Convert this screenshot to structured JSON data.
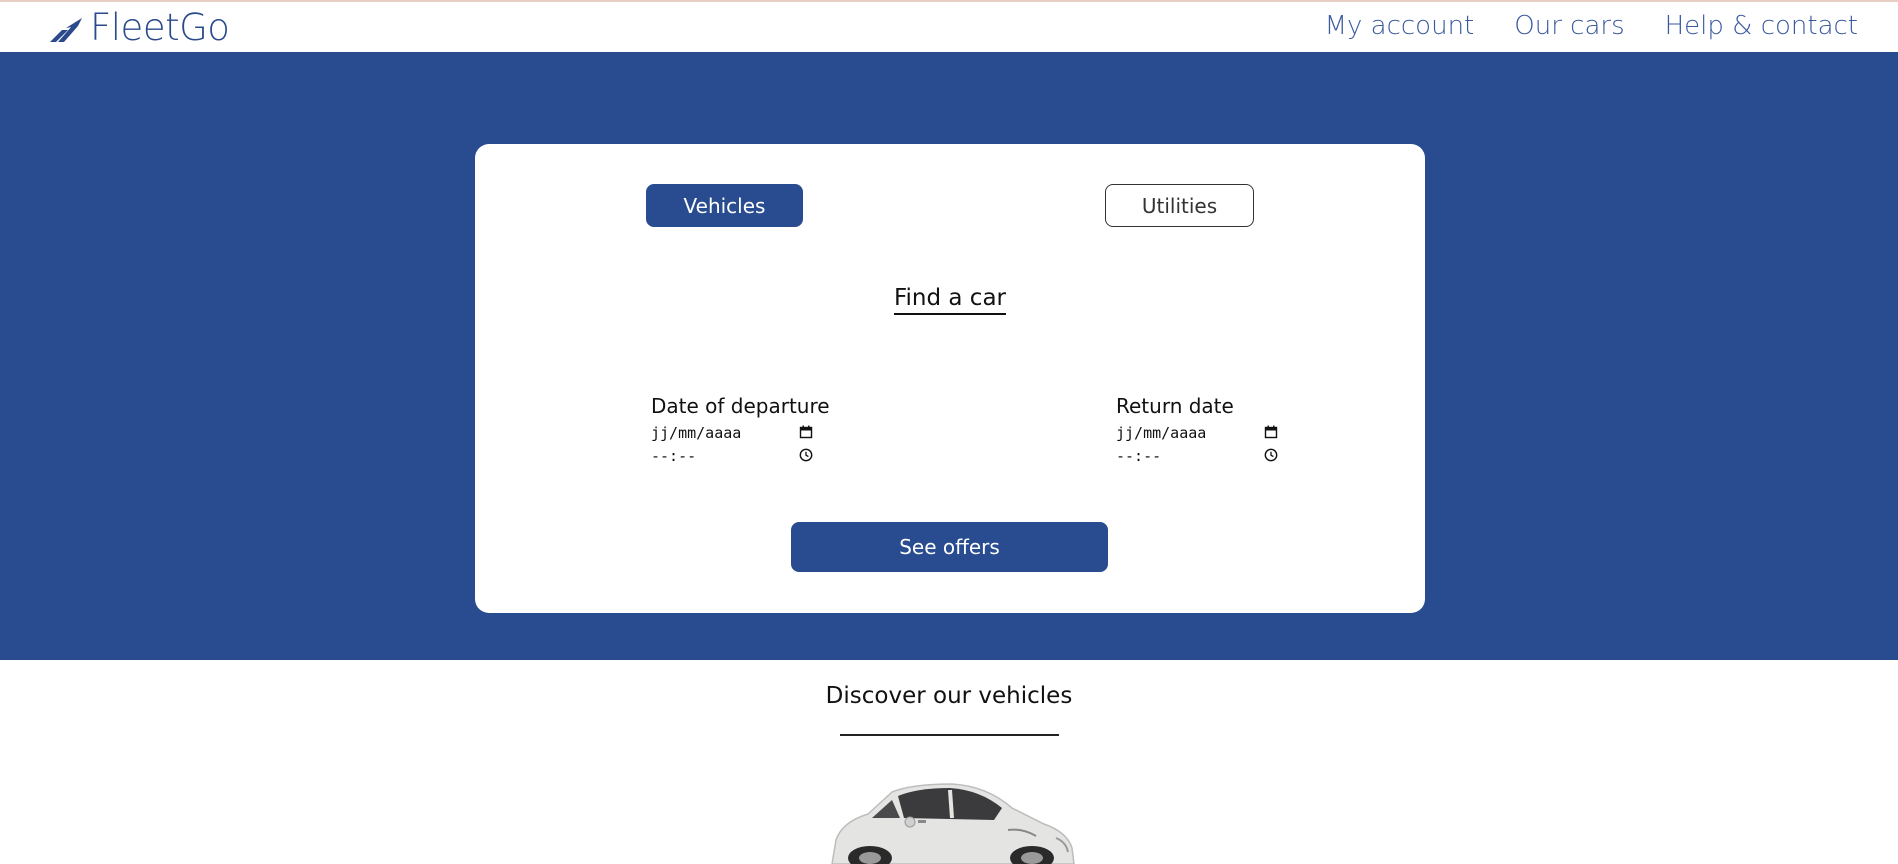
{
  "header": {
    "brand": "FleetGo",
    "nav": [
      "My account",
      "Our cars",
      "Help & contact"
    ]
  },
  "search": {
    "tabs": {
      "vehicles": "Vehicles",
      "utilities": "Utilities"
    },
    "title": "Find a car",
    "departure": {
      "label": "Date of departure",
      "date_placeholder": "jj/mm/aaaa",
      "time_placeholder": "--:--"
    },
    "return": {
      "label": "Return date",
      "date_placeholder": "jj/mm/aaaa",
      "time_placeholder": "--:--"
    },
    "submit": "See offers"
  },
  "discover": {
    "title": "Discover our vehicles"
  },
  "colors": {
    "brand": "#284c8f",
    "nav_text": "#3a5a9e"
  }
}
